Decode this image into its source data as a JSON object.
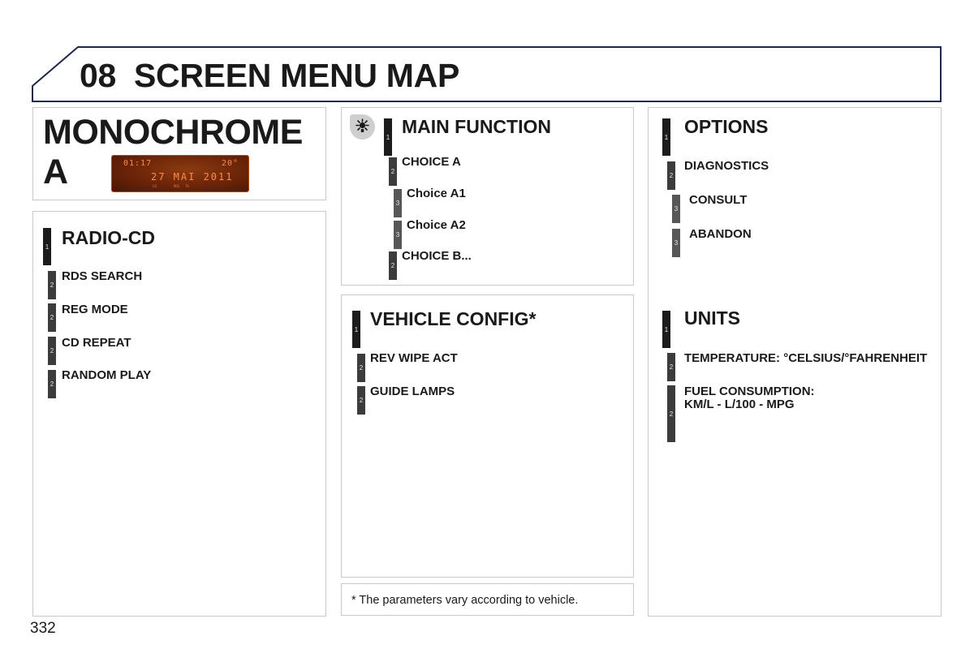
{
  "header": {
    "chapter": "08",
    "title": "SCREEN MENU MAP",
    "accent_color": "#1f2a4a"
  },
  "monochrome": {
    "title": "MONOCHROME A",
    "display": {
      "time": "01:17",
      "temperature": "20°",
      "date": "27 MAI 2011",
      "indicators": [
        "LO",
        "RDS",
        "TA"
      ]
    }
  },
  "radio_cd": {
    "heading": {
      "level": "1",
      "label": "RADIO-CD"
    },
    "items": [
      {
        "level": "2",
        "label": "RDS SEARCH"
      },
      {
        "level": "2",
        "label": "REG MODE"
      },
      {
        "level": "2",
        "label": "CD REPEAT"
      },
      {
        "level": "2",
        "label": "RANDOM PLAY"
      }
    ]
  },
  "main_function": {
    "icon": "light-bulb-icon",
    "heading": {
      "level": "1",
      "label": "MAIN FUNCTION"
    },
    "items": [
      {
        "level": "2",
        "label": "CHOICE A"
      },
      {
        "level": "3",
        "label": "Choice A1"
      },
      {
        "level": "3",
        "label": "Choice A2"
      },
      {
        "level": "2",
        "label": "CHOICE B..."
      }
    ]
  },
  "vehicle_config": {
    "heading": {
      "level": "1",
      "label": "VEHICLE CONFIG*"
    },
    "items": [
      {
        "level": "2",
        "label": "REV WIPE ACT"
      },
      {
        "level": "2",
        "label": "GUIDE LAMPS"
      }
    ]
  },
  "footnote": "* The parameters vary according to vehicle.",
  "options": {
    "heading": {
      "level": "1",
      "label": "OPTIONS"
    },
    "items": [
      {
        "level": "2",
        "label": "DIAGNOSTICS"
      },
      {
        "level": "3",
        "label": "CONSULT"
      },
      {
        "level": "3",
        "label": "ABANDON"
      }
    ]
  },
  "units": {
    "heading": {
      "level": "1",
      "label": "UNITS"
    },
    "items": [
      {
        "level": "2",
        "label": "TEMPERATURE: °CELSIUS/°FAHRENHEIT"
      },
      {
        "level": "2",
        "label": "FUEL CONSUMPTION:",
        "label2": "KM/L - L/100 - MPG"
      }
    ]
  },
  "page_number": "332"
}
